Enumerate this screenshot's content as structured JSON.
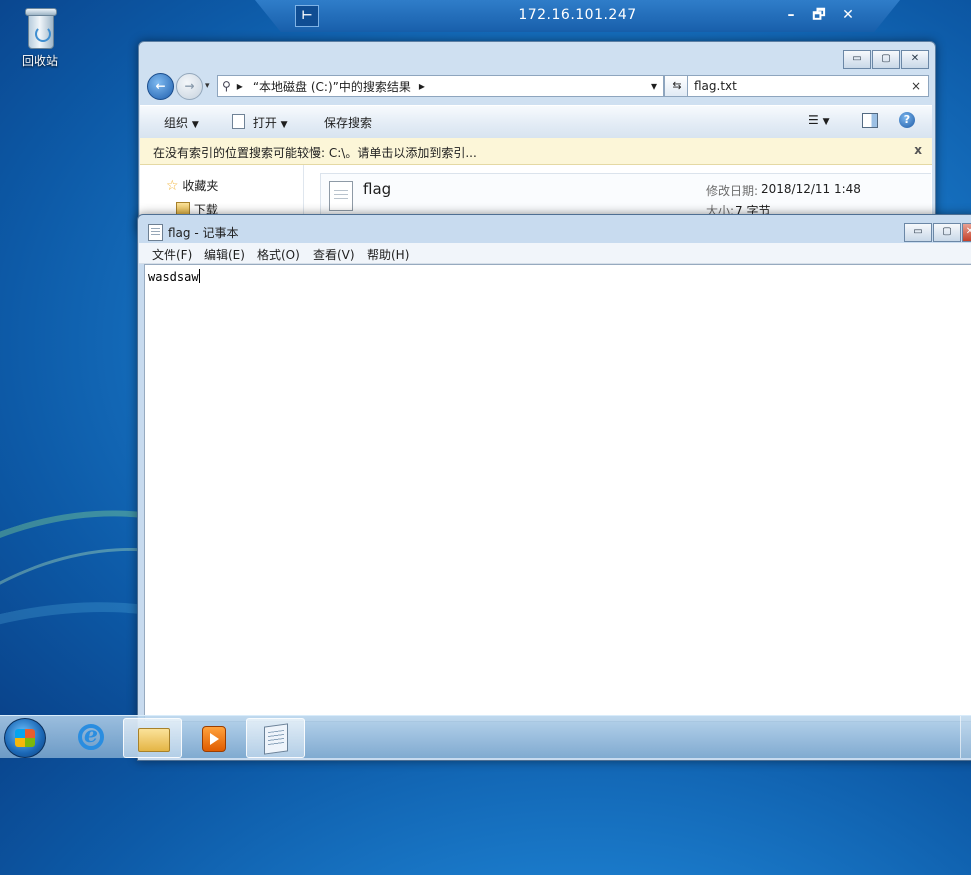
{
  "desktop": {
    "recycle_bin_label": "回收站"
  },
  "remote_bar": {
    "host": "172.16.101.247",
    "pin_icon": "pin-icon",
    "minimize_glyph": "–",
    "restore_glyph": "🗗",
    "close_glyph": "✕"
  },
  "explorer": {
    "path_arrow": "▸",
    "path_text": "“本地磁盘 (C:)”中的搜索结果",
    "path_arrow_end": "▸",
    "dropdown_glyph": "▾",
    "refresh_glyph": "⇆",
    "search_value": "flag.txt",
    "search_clear": "×",
    "toolbar": {
      "organize": "组织",
      "open": "打开",
      "save_search": "保存搜索"
    },
    "info_bar": {
      "text": "在没有索引的位置搜索可能较慢: C:\\。请单击以添加到索引...",
      "close": "x"
    },
    "nav": {
      "favorites": "收藏夹",
      "downloads": "下载"
    },
    "result": {
      "name": "flag",
      "modified_label": "修改日期:",
      "modified_value": "2018/12/11 1:48",
      "size_label": "大小:",
      "size_value": "7 字节"
    },
    "caption": {
      "min": "▭",
      "max": "▢",
      "close": "✕"
    }
  },
  "notepad": {
    "title": "flag - 记事本",
    "menu": {
      "file": "文件(F)",
      "edit": "编辑(E)",
      "format": "格式(O)",
      "view": "查看(V)",
      "help": "帮助(H)"
    },
    "content": "wasdsaw",
    "caption": {
      "min": "▭",
      "max": "▢",
      "close": "✕"
    }
  },
  "taskbar": {
    "items": [
      "start-button",
      "ie",
      "explorer",
      "media-player",
      "notepad"
    ]
  }
}
